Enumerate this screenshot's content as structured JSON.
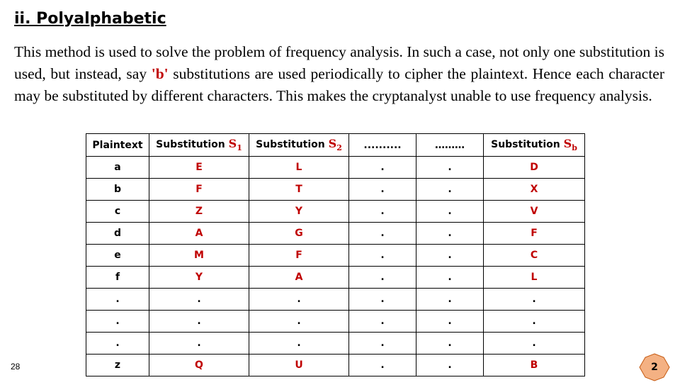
{
  "heading": "ii. Polyalphabetic",
  "paragraph": {
    "before": "This method is used to solve the problem of frequency analysis. In such a case, not only one substitution is used, but instead, say ",
    "highlight": "'b'",
    "after": "  substitutions are used periodically to cipher the plaintext. Hence each character may be substituted by different characters. This makes the cryptanalyst unable to use frequency analysis."
  },
  "table": {
    "headers": {
      "plaintext": "Plaintext",
      "sub1_prefix": "Substitution ",
      "sub1_symbol": "S",
      "sub1_index": "1",
      "sub2_prefix": "Substitution ",
      "sub2_symbol": "S",
      "sub2_index": "2",
      "dots1": "..........",
      "dots2": "………",
      "subb_prefix": "Substitution ",
      "subb_symbol": "S",
      "subb_index": "b"
    },
    "rows": [
      [
        "a",
        "E",
        "L",
        ".",
        ".",
        "D"
      ],
      [
        "b",
        "F",
        "T",
        ".",
        ".",
        "X"
      ],
      [
        "c",
        "Z",
        "Y",
        ".",
        ".",
        "V"
      ],
      [
        "d",
        "A",
        "G",
        ".",
        ".",
        "F"
      ],
      [
        "e",
        "M",
        "F",
        ".",
        ".",
        "C"
      ],
      [
        "f",
        "Y",
        "A",
        ".",
        ".",
        "L"
      ],
      [
        ".",
        ".",
        ".",
        ".",
        ".",
        "."
      ],
      [
        ".",
        ".",
        ".",
        ".",
        ".",
        "."
      ],
      [
        ".",
        ".",
        ".",
        ".",
        ".",
        "."
      ],
      [
        "z",
        "Q",
        "U",
        ".",
        ".",
        "B"
      ]
    ]
  },
  "footer": {
    "page_number": "28",
    "slide_number": "2",
    "badge_fill": "#f4b183",
    "badge_stroke": "#c55a11"
  }
}
